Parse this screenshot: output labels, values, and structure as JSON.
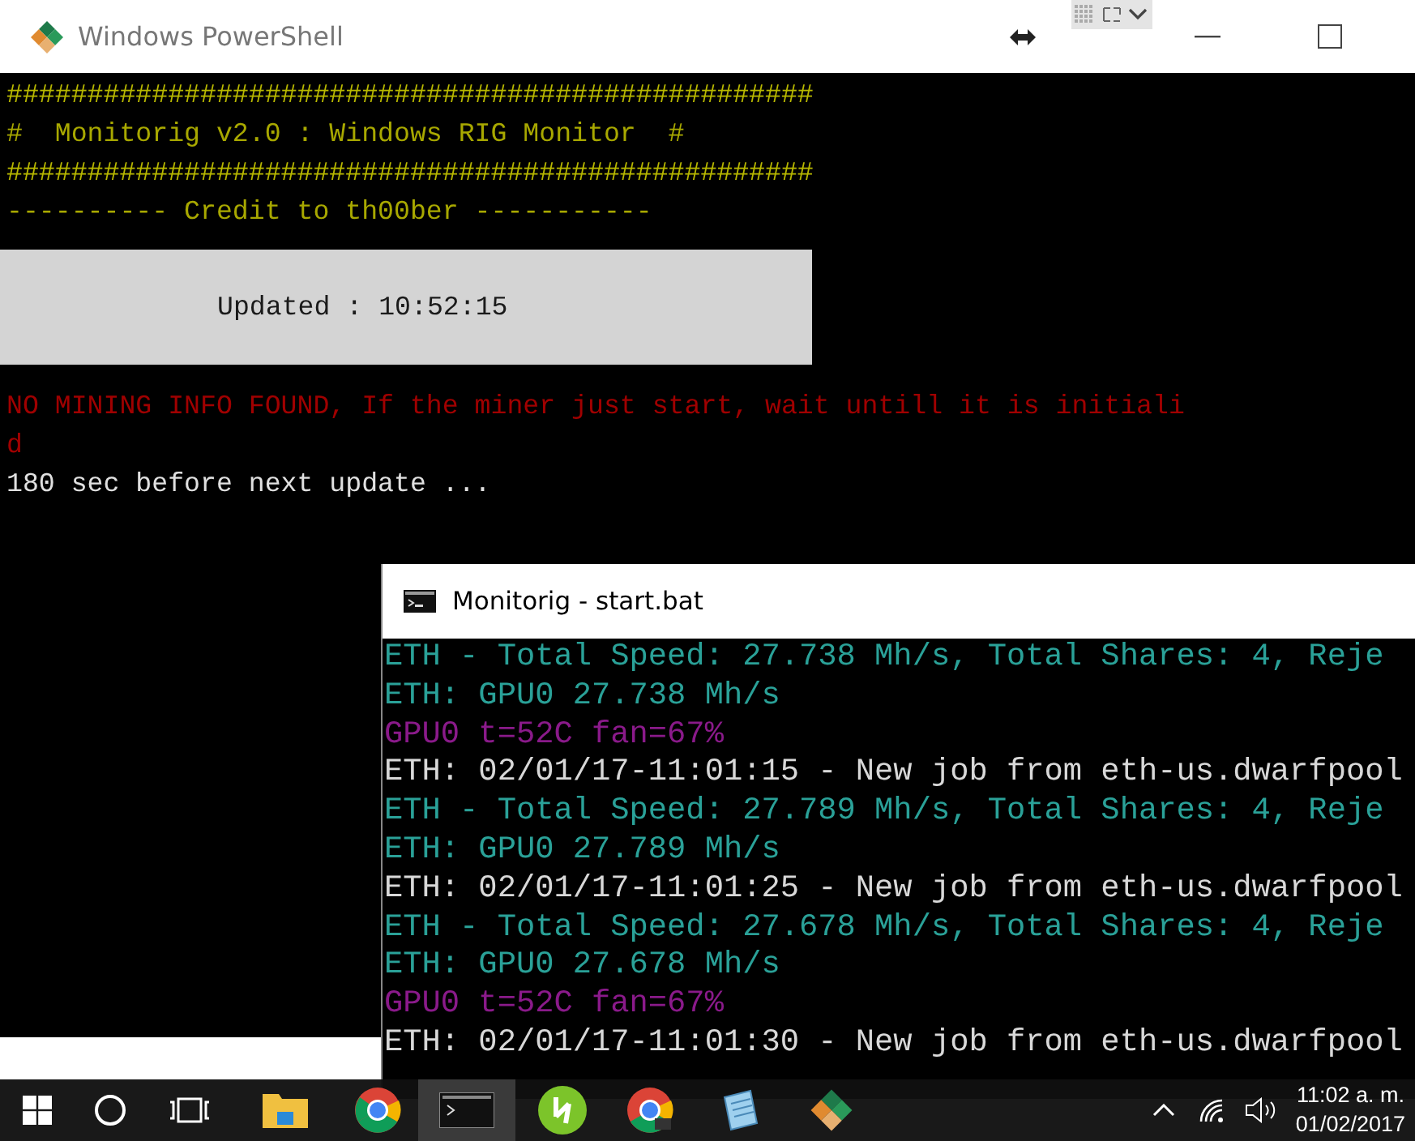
{
  "powershell_window": {
    "title": "Windows PowerShell",
    "header_lines": [
      {
        "text": "##################################################",
        "kind": "rule"
      },
      {
        "text": "#  Monitorig v2.0 : Windows RIG Monitor  #",
        "kind": "title"
      },
      {
        "text": "##################################################",
        "kind": "rule"
      },
      {
        "text": "---------- Credit to th00ber -----------",
        "kind": "credit"
      }
    ],
    "updated_banner": "Updated : 10:52:15",
    "error_lines": [
      "NO MINING INFO FOUND, If the miner just start, wait untill it is initiali",
      "d"
    ],
    "footer_line": "180 sec before next update ..."
  },
  "cmd_window": {
    "title": "Monitorig - start.bat",
    "lines": [
      {
        "text": "ETH - Total Speed: 27.738 Mh/s, Total Shares: 4, Reje",
        "kind": "speed"
      },
      {
        "text": "ETH: GPU0 27.738 Mh/s",
        "kind": "speed"
      },
      {
        "text": "GPU0 t=52C fan=67%",
        "kind": "temp"
      },
      {
        "text": "ETH: 02/01/17-11:01:15 - New job from eth-us.dwarfpool",
        "kind": "job"
      },
      {
        "text": "ETH - Total Speed: 27.789 Mh/s, Total Shares: 4, Reje",
        "kind": "speed"
      },
      {
        "text": "ETH: GPU0 27.789 Mh/s",
        "kind": "speed"
      },
      {
        "text": "ETH: 02/01/17-11:01:25 - New job from eth-us.dwarfpool",
        "kind": "job"
      },
      {
        "text": "ETH - Total Speed: 27.678 Mh/s, Total Shares: 4, Reje",
        "kind": "speed"
      },
      {
        "text": "ETH: GPU0 27.678 Mh/s",
        "kind": "speed"
      },
      {
        "text": "GPU0 t=52C fan=67%",
        "kind": "temp"
      },
      {
        "text": "ETH: 02/01/17-11:01:30 - New job from eth-us.dwarfpool",
        "kind": "job"
      }
    ]
  },
  "taskbar": {
    "clock_time": "11:02 a. m.",
    "clock_date": "01/02/2017"
  }
}
